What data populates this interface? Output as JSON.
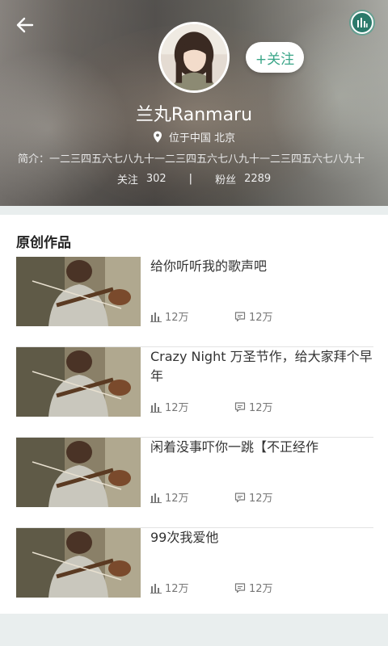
{
  "header": {
    "user_name": "兰丸Ranmaru",
    "location": "位于中国 北京",
    "bio": "简介：一二三四五六七八九十一二三四五六七八九十一二三四五六七八九十",
    "follow_label": "+关注",
    "following_label": "关注",
    "following_count": "302",
    "divider": "|",
    "fans_label": "粉丝",
    "fans_count": "2289"
  },
  "section": {
    "title": "原创作品"
  },
  "works": [
    {
      "title": "给你听听我的歌声吧",
      "plays": "12万",
      "comments": "12万"
    },
    {
      "title": "Crazy Night 万圣节作，给大家拜个早年",
      "plays": "12万",
      "comments": "12万"
    },
    {
      "title": "闲着没事吓你一跳【不正经作",
      "plays": "12万",
      "comments": "12万"
    },
    {
      "title": "99次我爱他",
      "plays": "12万",
      "comments": "12万"
    }
  ],
  "colors": {
    "accent": "#3aa588",
    "music_button": "#2b7a6b"
  },
  "icons": [
    "back-arrow-icon",
    "music-bars-icon",
    "location-pin-icon",
    "plays-bar-icon",
    "comment-icon"
  ]
}
